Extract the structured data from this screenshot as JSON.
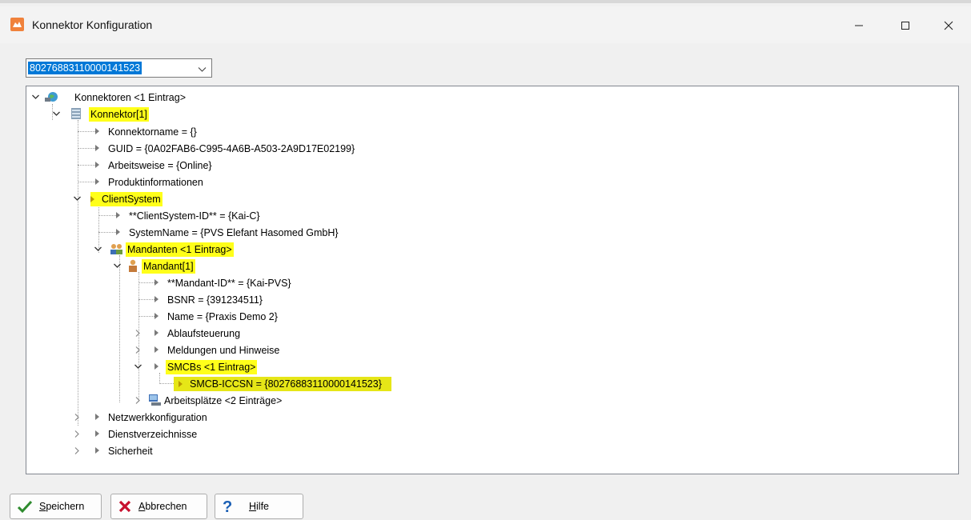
{
  "window": {
    "title": "Konnektor Konfiguration"
  },
  "combo": {
    "value": "80276883110000141523"
  },
  "tree": {
    "root": "Konnektoren <1 Eintrag>",
    "konnektor": "Konnektor[1]",
    "konnektorname": "Konnektorname = {}",
    "guid": "GUID = {0A02FAB6-C995-4A6B-A503-2A9D17E02199}",
    "arbeitsweise": "Arbeitsweise = {Online}",
    "produktinformationen": "Produktinformationen",
    "clientsystem": "ClientSystem",
    "clientsystem_id": "**ClientSystem-ID** = {Kai-C}",
    "systemname": "SystemName = {PVS Elefant Hasomed GmbH}",
    "mandanten": "Mandanten <1 Eintrag>",
    "mandant": "Mandant[1]",
    "mandant_id": "**Mandant-ID** = {Kai-PVS}",
    "bsnr": "BSNR = {391234511}",
    "name": "Name = {Praxis Demo 2}",
    "ablaufsteuerung": "Ablaufsteuerung",
    "meldungen": "Meldungen und Hinweise",
    "smcbs": "SMCBs <1 Eintrag>",
    "smcb_iccsn": "SMCB-ICCSN = {80276883110000141523}",
    "arbeitsplaetze": "Arbeitsplätze <2 Einträge>",
    "netzwerk": "Netzwerkkonfiguration",
    "dienstverzeichnisse": "Dienstverzeichnisse",
    "sicherheit": "Sicherheit"
  },
  "buttons": {
    "save_accel": "S",
    "save_rest": "peichern",
    "cancel_accel": "A",
    "cancel_rest": "bbrechen",
    "help_accel": "H",
    "help_rest": "ilfe"
  },
  "colors": {
    "highlight": "#ffff1a",
    "selection": "#0078d7"
  }
}
